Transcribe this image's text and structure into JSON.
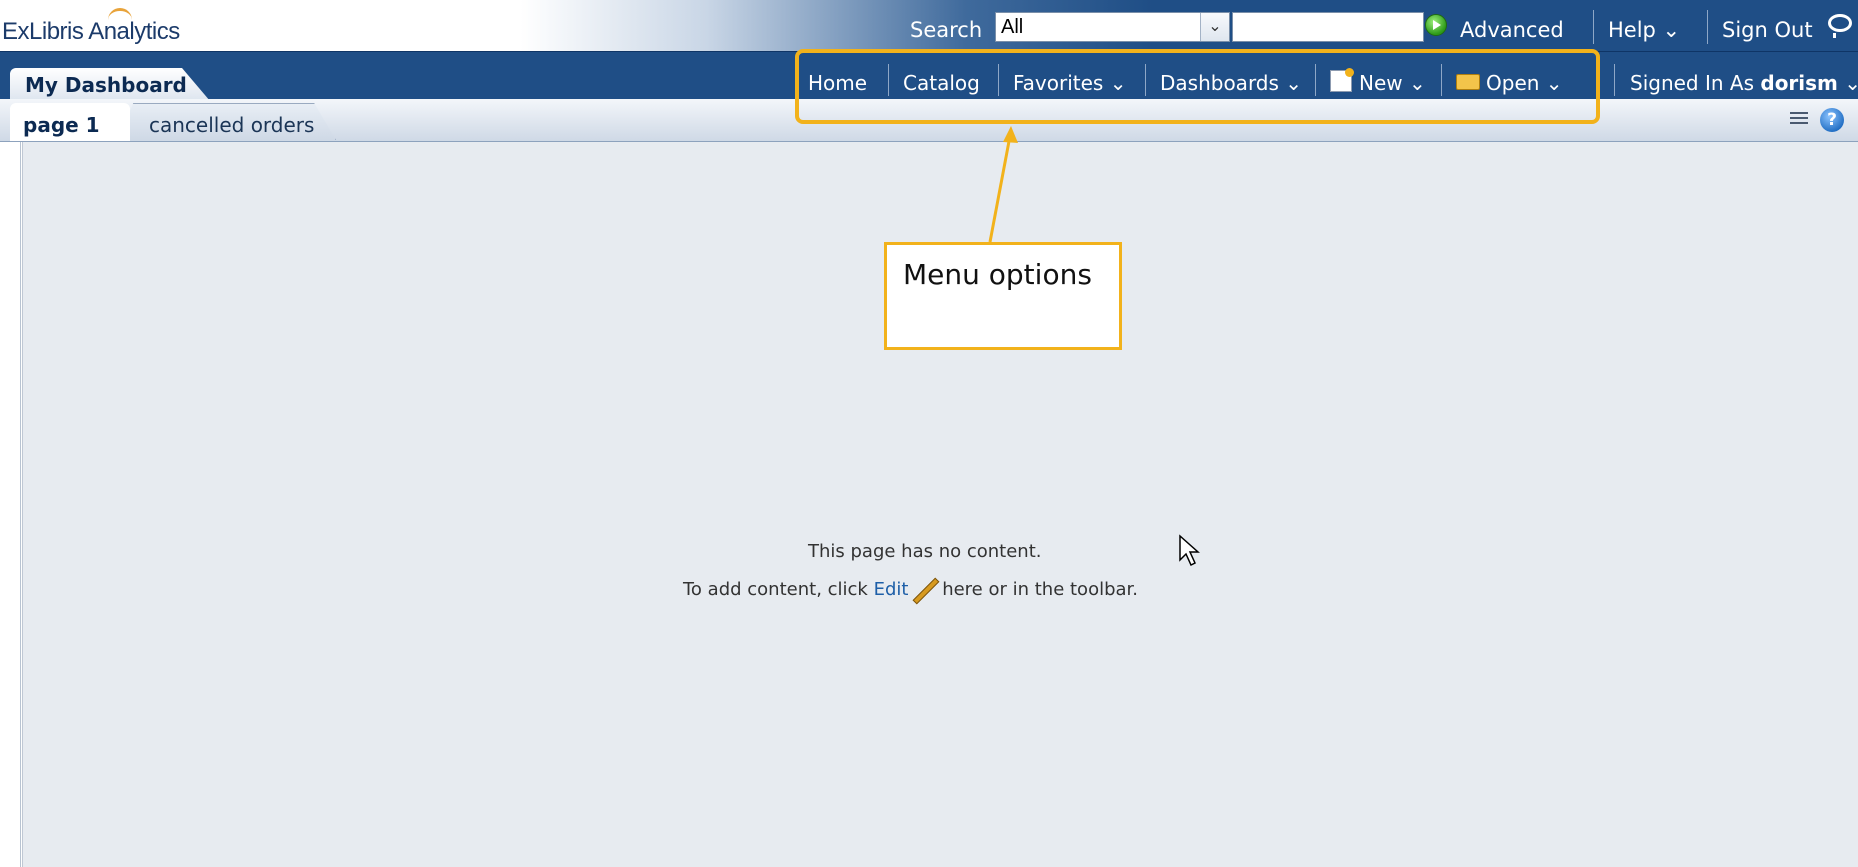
{
  "header": {
    "logo": "ExLibris Analytics",
    "search_label": "Search",
    "search_scope": "All",
    "advanced": "Advanced",
    "help": "Help ⌄",
    "signout": "Sign Out"
  },
  "dashbar": {
    "title": "My Dashboard",
    "menu": {
      "home": "Home",
      "catalog": "Catalog",
      "favorites": "Favorites ⌄",
      "dashboards": "Dashboards ⌄",
      "new": "New ⌄",
      "open": "Open ⌄"
    },
    "signed_in_prefix": "Signed In As",
    "user": "dorism",
    "user_caret": "⌄"
  },
  "tabs": [
    {
      "label": "page 1"
    },
    {
      "label": "cancelled orders"
    }
  ],
  "content": {
    "line1": "This page has no content.",
    "line2_prefix": "To add content, click",
    "edit_link": "Edit",
    "line2_suffix": "here or in the toolbar."
  },
  "annotation": {
    "callout_text": "Menu options"
  },
  "colors": {
    "nav_blue": "#1f4e86",
    "annotation_yellow": "#f2b21b",
    "content_bg": "#e7ebf0"
  }
}
